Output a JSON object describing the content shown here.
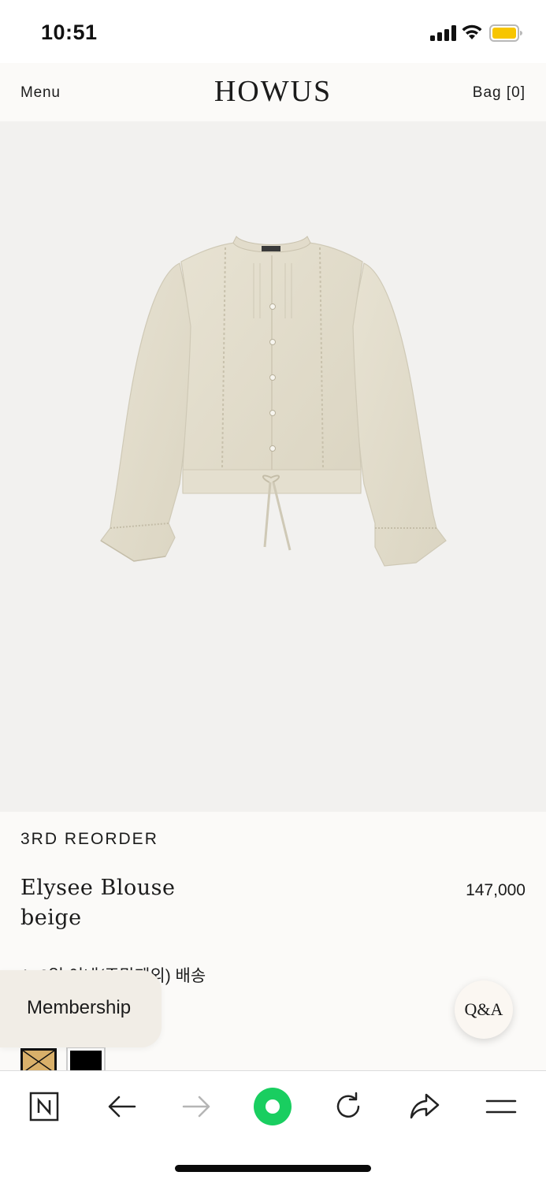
{
  "status_bar": {
    "time": "10:51"
  },
  "header": {
    "menu_label": "Menu",
    "brand": "HOWUS",
    "bag_label": "Bag [0]"
  },
  "product": {
    "badge": "3RD REORDER",
    "name_line1": "Elysee Blouse",
    "name_line2": "beige",
    "price": "147,000",
    "shipping_note": "1~3일 이내(주말제외) 배송",
    "swatches": [
      {
        "name": "gold",
        "color": "#d9b06a"
      },
      {
        "name": "black",
        "color": "#000000"
      }
    ]
  },
  "floating": {
    "membership_label": "Membership",
    "qa_label": "Q&A"
  },
  "browser_toolbar": {
    "icons": [
      "naver-icon",
      "back-arrow-icon",
      "forward-arrow-icon",
      "green-dot-icon",
      "reload-icon",
      "share-icon",
      "menu-icon"
    ],
    "accent_color": "#19ce60"
  }
}
